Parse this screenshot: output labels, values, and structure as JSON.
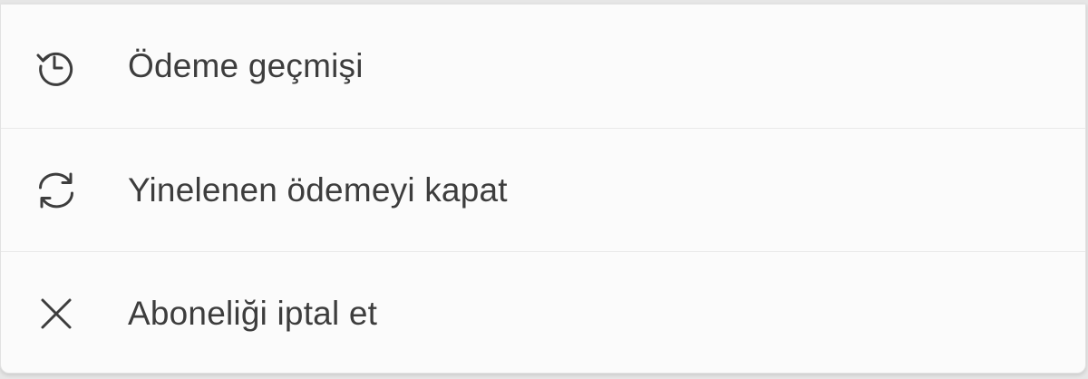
{
  "menu": {
    "items": [
      {
        "icon": "history-icon",
        "label": "Ödeme geçmişi"
      },
      {
        "icon": "refresh-icon",
        "label": "Yinelenen ödemeyi kapat"
      },
      {
        "icon": "close-icon",
        "label": "Aboneliği iptal et"
      }
    ]
  }
}
